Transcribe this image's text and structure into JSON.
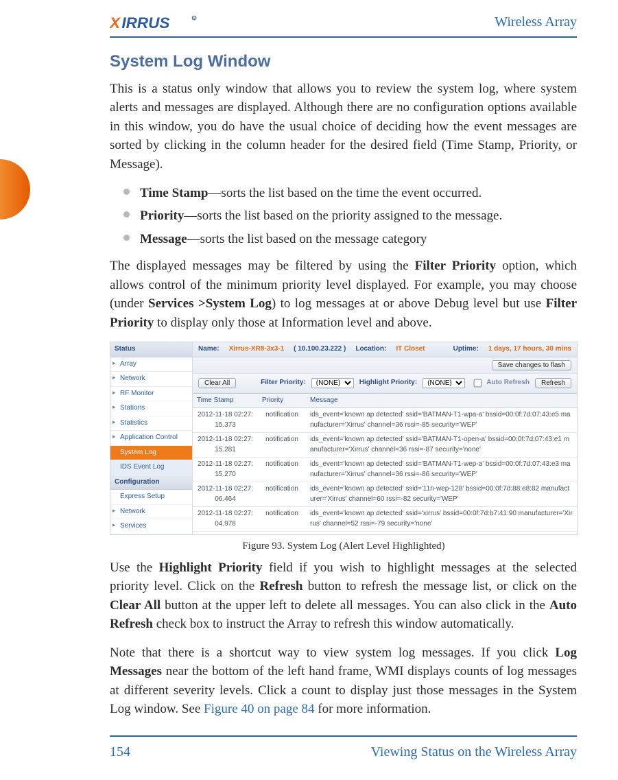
{
  "header": {
    "book_title": "Wireless Array"
  },
  "logo": {
    "text_main": "XIRRUS",
    "orange_letter_index": 0
  },
  "sidetab": {
    "color": "#ea6a1b"
  },
  "section": {
    "title": "System Log Window"
  },
  "para": {
    "intro": "This is a status only window that allows you to review the system log, where system alerts and messages are displayed. Although there are no configuration options available in this window, you do have the usual choice of deciding how the event messages are sorted by clicking in the column header for the desired field (Time Stamp, Priority, or Message).",
    "filter_a": "The displayed messages may be filtered by using the ",
    "filter_b": "Filter Priority",
    "filter_c": " option, which allows control of the minimum priority level displayed. For example, you may choose (under ",
    "filter_d": "Services >System Log",
    "filter_e": ") to log messages at or above Debug level but use ",
    "filter_f": "Filter Priority",
    "filter_g": " to display only those at Information level and above.",
    "use_a": "Use the ",
    "use_b": "Highlight Priority",
    "use_c": " field if you wish to highlight messages at the selected priority level. Click on the ",
    "use_d": "Refresh",
    "use_e": " button to refresh the message list, or click on the ",
    "use_f": "Clear All",
    "use_g": " button at the upper left to delete all messages. You can also click in the ",
    "use_h": "Auto Refresh",
    "use_i": " check box to instruct the Array to refresh this window automatically.",
    "note_a": "Note that there is a shortcut way to view system log messages. If you click ",
    "note_b": "Log Messages",
    "note_c": " near the bottom of the left hand frame, WMI displays counts of log messages at different severity levels. Click a count to display just those messages in the System Log window. See ",
    "note_link": "Figure 40 on page 84",
    "note_d": " for more information."
  },
  "bullets": [
    {
      "term": "Time Stamp",
      "desc": "—sorts the list based on the time the event occurred."
    },
    {
      "term": "Priority",
      "desc": "—sorts the list based on the priority assigned to the message."
    },
    {
      "term": "Message",
      "desc": "—sorts the list based on the message category"
    }
  ],
  "figure": {
    "caption": "Figure 93. System Log (Alert Level Highlighted)"
  },
  "ui": {
    "sidebar": {
      "status_header": "Status",
      "config_header": "Configuration",
      "status_items": [
        {
          "label": "Array"
        },
        {
          "label": "Network"
        },
        {
          "label": "RF Monitor"
        },
        {
          "label": "Stations"
        },
        {
          "label": "Statistics"
        },
        {
          "label": "Application Control"
        },
        {
          "label": "System Log",
          "selected": true,
          "plain": true
        },
        {
          "label": "IDS Event Log",
          "sub": true,
          "plain": true
        }
      ],
      "config_items": [
        {
          "label": "Express Setup",
          "plain": true
        },
        {
          "label": "Network"
        },
        {
          "label": "Services"
        }
      ]
    },
    "topbar": {
      "name_k": "Name:",
      "name_v": "Xirrus-XR8-3x3-1",
      "ip": "( 10.100.23.222 )",
      "loc_k": "Location:",
      "loc_v": "IT Closet",
      "up_k": "Uptime:",
      "up_v": "1 days, 17 hours, 30 mins"
    },
    "buttons": {
      "save": "Save changes to flash",
      "clear": "Clear All",
      "refresh": "Refresh"
    },
    "filterbar": {
      "filter_label": "Filter Priority:",
      "highlight_label": "Highlight Priority:",
      "auto_label": "Auto Refresh",
      "filter_value": "(NONE)",
      "highlight_value": "(NONE)"
    },
    "table": {
      "cols": [
        "Time Stamp",
        "Priority",
        "Message"
      ],
      "rows": [
        {
          "ts": "2012-11-18 02:27:15.373",
          "prio": "notification",
          "msg": "ids_event='known ap detected' ssid='BATMAN-T1-wpa-a' bssid=00:0f:7d:07:43:e5 manufacturer='Xirrus' channel=36 rssi=-85 security='WEP'"
        },
        {
          "ts": "2012-11-18 02:27:15.281",
          "prio": "notification",
          "msg": "ids_event='known ap detected' ssid='BATMAN-T1-open-a' bssid=00:0f:7d:07:43:e1 manufacturer='Xirrus' channel=36 rssi=-87 security='none'"
        },
        {
          "ts": "2012-11-18 02:27:15.270",
          "prio": "notification",
          "msg": "ids_event='known ap detected' ssid='BATMAN-T1-wep-a' bssid=00:0f:7d:07:43:e3 manufacturer='Xirrus' channel=36 rssi=-86 security='WEP'"
        },
        {
          "ts": "2012-11-18 02:27:06.464",
          "prio": "notification",
          "msg": "ids_event='known ap detected' ssid='11n-wep-128' bssid=00:0f:7d:88:e8:82 manufacturer='Xirrus' channel=60 rssi=-82 security='WEP'"
        },
        {
          "ts": "2012-11-18 02:27:04.978",
          "prio": "notification",
          "msg": "ids_event='known ap detected' ssid='xirrus' bssid=00:0f:7d:b7:41:90 manufacturer='Xirrus' channel=52 rssi=-79 security='none'"
        }
      ]
    }
  },
  "footer": {
    "page_no": "154",
    "section": "Viewing Status on the Wireless Array"
  }
}
